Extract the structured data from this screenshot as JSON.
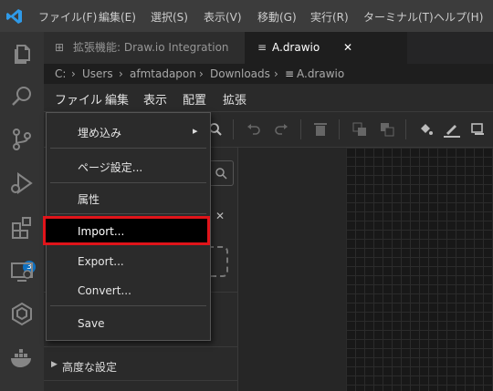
{
  "titlebar": {
    "menus": [
      "ファイル(F)",
      "編集(E)",
      "選択(S)",
      "表示(V)",
      "移動(G)",
      "実行(R)",
      "ターミナル(T)",
      "ヘルプ(H)"
    ]
  },
  "activity": {
    "extensions_badge": "3"
  },
  "tabs": [
    {
      "label": "拡張機能: Draw.io Integration"
    },
    {
      "label": "A.drawio",
      "close": "✕"
    }
  ],
  "breadcrumb": [
    "C:",
    "Users",
    "afmtadapon",
    "Downloads",
    "A.drawio"
  ],
  "drawio_menu": [
    "ファイル",
    "編集",
    "表示",
    "配置",
    "拡張"
  ],
  "file_menu": {
    "items": [
      {
        "label": "埋め込み",
        "submenu": "▸"
      },
      {
        "label": "ページ設定..."
      },
      {
        "label": "属性"
      },
      {
        "label": "Import..."
      },
      {
        "label": "Export..."
      },
      {
        "label": "Convert..."
      },
      {
        "label": "Save"
      }
    ]
  },
  "left_panel": {
    "advanced_label": "高度な設定",
    "close_label": "✕"
  },
  "colors": {
    "titlebar": "#3c3c3c",
    "activity": "#333333",
    "highlight": "#e0141a",
    "badge": "#0e70c0"
  }
}
